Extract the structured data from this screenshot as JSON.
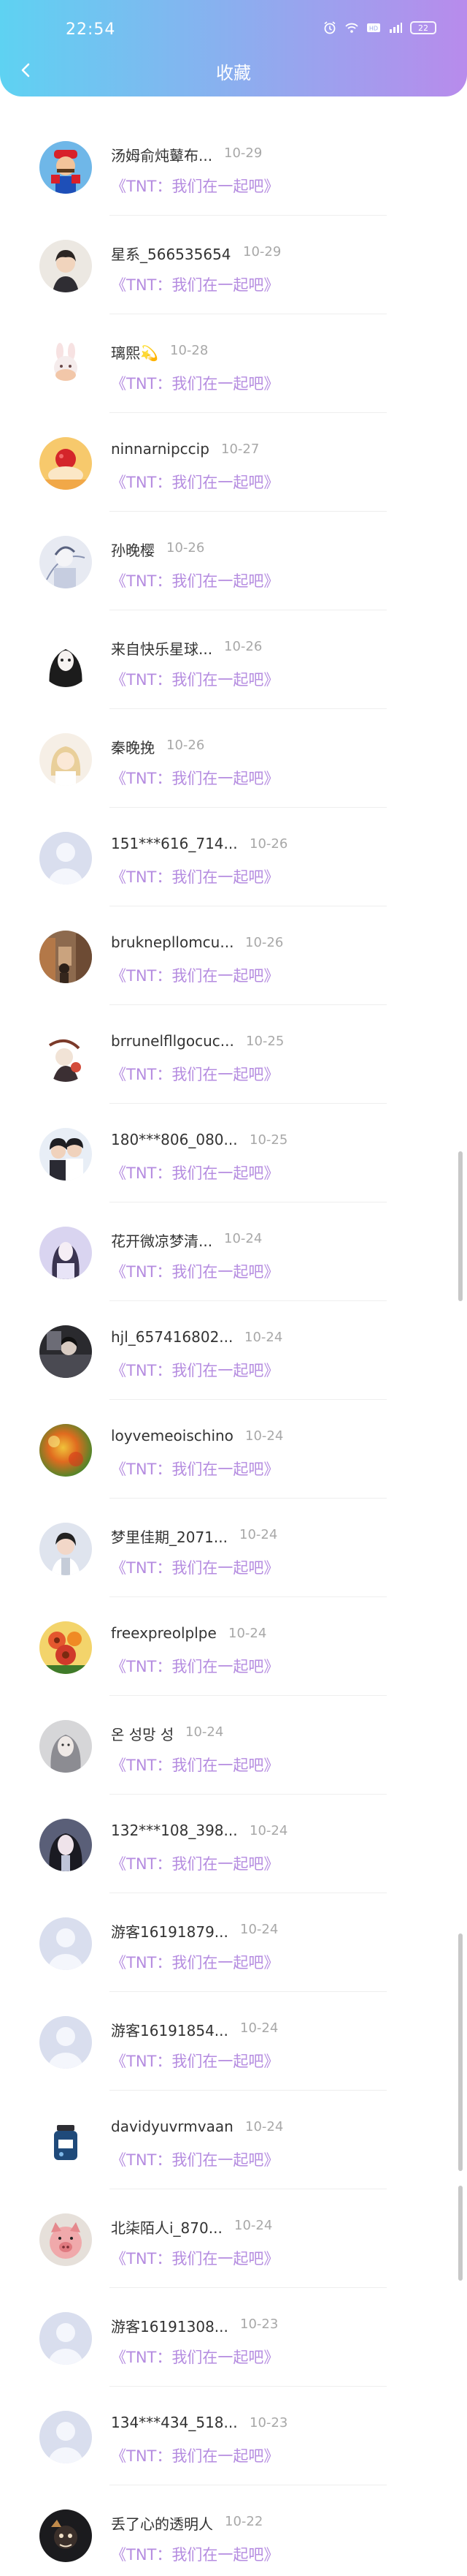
{
  "status_bar": {
    "time": "22:54",
    "battery": "22"
  },
  "header": {
    "title": "收藏",
    "gradient_start": "#5ed2f2",
    "gradient_end": "#b88bec"
  },
  "favorite_title": "《TNT：我们在一起吧》",
  "items": [
    {
      "name": "汤姆俞炖鼙布...",
      "date": "10-29",
      "avatar": "mario"
    },
    {
      "name": "星系_566535654",
      "date": "10-29",
      "avatar": "boy"
    },
    {
      "name": "璃熙💫",
      "date": "10-28",
      "avatar": "bunny"
    },
    {
      "name": "ninnarnipccip",
      "date": "10-27",
      "avatar": "fruit"
    },
    {
      "name": "孙晚樱",
      "date": "10-26",
      "avatar": "sketch"
    },
    {
      "name": "来自快乐星球...",
      "date": "10-26",
      "avatar": "anime"
    },
    {
      "name": "秦晚挽",
      "date": "10-26",
      "avatar": "cartoon-girl"
    },
    {
      "name": "151***616_714...",
      "date": "10-26",
      "avatar": "default"
    },
    {
      "name": "bruknepllomcu...",
      "date": "10-26",
      "avatar": "street"
    },
    {
      "name": "brrunelfllgocuc...",
      "date": "10-25",
      "avatar": "drawing"
    },
    {
      "name": "180***806_080...",
      "date": "10-25",
      "avatar": "couple"
    },
    {
      "name": "花开微凉梦清...",
      "date": "10-24",
      "avatar": "girl-purple"
    },
    {
      "name": "hjl_657416802...",
      "date": "10-24",
      "avatar": "dark-photo"
    },
    {
      "name": "loyvemeoischino",
      "date": "10-24",
      "avatar": "bokeh"
    },
    {
      "name": "梦里佳期_2071...",
      "date": "10-24",
      "avatar": "singer"
    },
    {
      "name": "freexpreolplpe",
      "date": "10-24",
      "avatar": "flowers"
    },
    {
      "name": "온 성망 성",
      "date": "10-24",
      "avatar": "gray-girl"
    },
    {
      "name": "132***108_398...",
      "date": "10-24",
      "avatar": "selfie"
    },
    {
      "name": "游客16191879...",
      "date": "10-24",
      "avatar": "default"
    },
    {
      "name": "游客16191854...",
      "date": "10-24",
      "avatar": "default"
    },
    {
      "name": "davidyuvrmvaan",
      "date": "10-24",
      "avatar": "jar"
    },
    {
      "name": "北柒陌人i_870...",
      "date": "10-24",
      "avatar": "pig"
    },
    {
      "name": "游客16191308...",
      "date": "10-23",
      "avatar": "default"
    },
    {
      "name": "134***434_518...",
      "date": "10-23",
      "avatar": "default"
    },
    {
      "name": "丢了心的透明人",
      "date": "10-22",
      "avatar": "dark-cartoon"
    }
  ]
}
